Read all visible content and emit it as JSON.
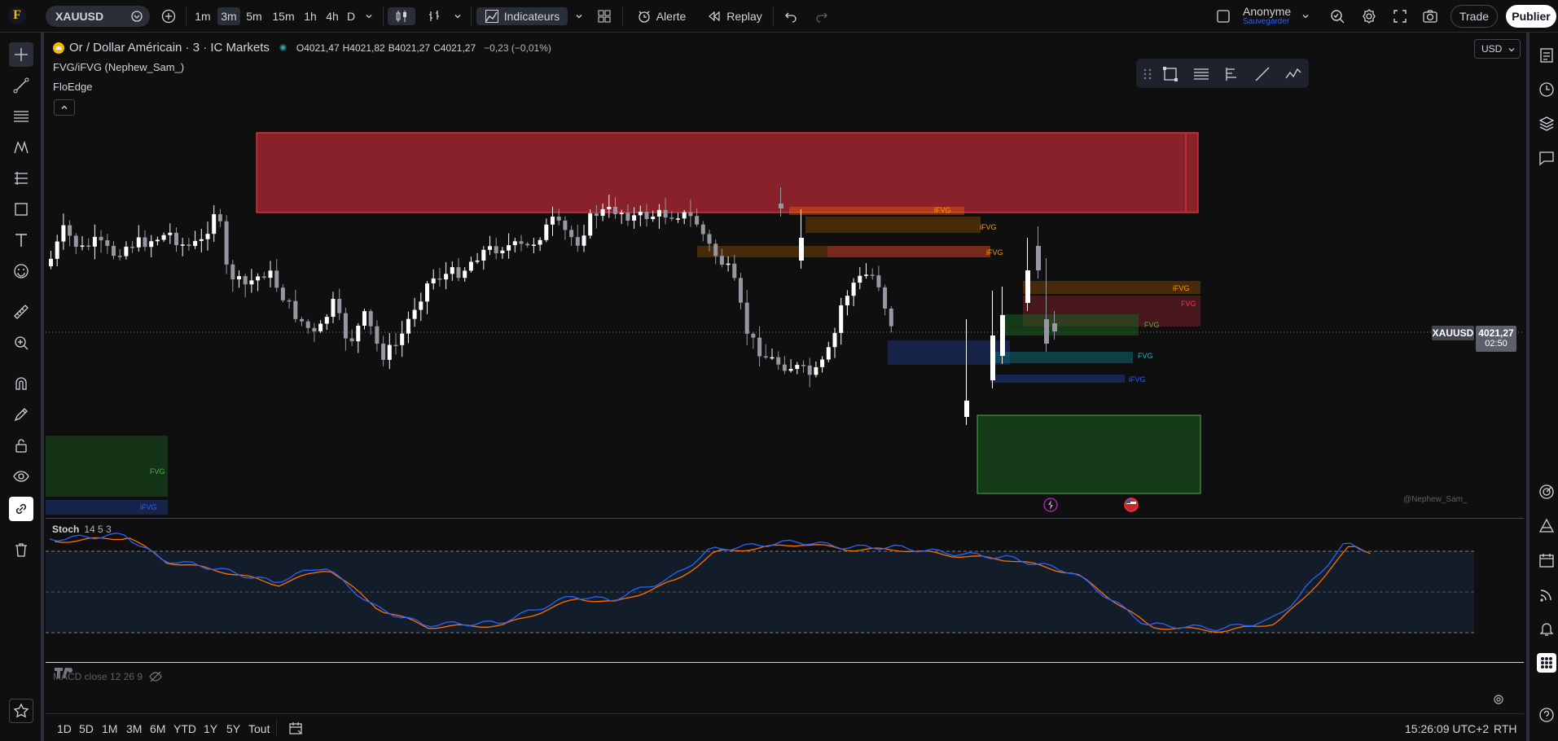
{
  "topbar": {
    "logo_letter": "F",
    "symbol": "XAUUSD",
    "timeframes": [
      "1m",
      "3m",
      "5m",
      "15m",
      "1h",
      "4h",
      "D"
    ],
    "active_timeframe": "3m",
    "indicators_label": "Indicateurs",
    "alert_label": "Alerte",
    "replay_label": "Replay",
    "user_name": "Anonyme",
    "save_label": "Sauvegarder",
    "trade_label": "Trade",
    "publish_label": "Publier"
  },
  "legend": {
    "title": "Or / Dollar Américain · 3 · IC Markets",
    "ohlc": [
      {
        "k": "O",
        "v": "4021,47"
      },
      {
        "k": "H",
        "v": "4021,82"
      },
      {
        "k": "B",
        "v": "4021,27"
      },
      {
        "k": "C",
        "v": "4021,27"
      }
    ],
    "change": "−0,23 (−0,01%)",
    "indicator1": "FVG/iFVG (Nephew_Sam_)",
    "indicator2": "FloEdge"
  },
  "currency": "USD",
  "price_label": {
    "symbol": "XAUUSD",
    "price": "4021,27",
    "countdown": "02:50"
  },
  "watermark": "@Nephew_Sam_",
  "zone_labels": {
    "fvg": "FVG",
    "ifvg": "iFVG"
  },
  "stoch": {
    "name": "Stoch",
    "params": "14 5 3"
  },
  "macd": {
    "label": "MACD close 12 26 9"
  },
  "bottom": {
    "ranges": [
      "1D",
      "5D",
      "1M",
      "3M",
      "6M",
      "YTD",
      "1Y",
      "5Y",
      "Tout"
    ],
    "time": "15:26:09 UTC+2",
    "session": "RTH"
  },
  "colors": {
    "bull": "#ffffff",
    "bear": "#9598a1",
    "supply_zone": "#b22833",
    "demand_zone": "#1b5e20",
    "stoch_k": "#2962ff",
    "stoch_d": "#ff6d00"
  }
}
